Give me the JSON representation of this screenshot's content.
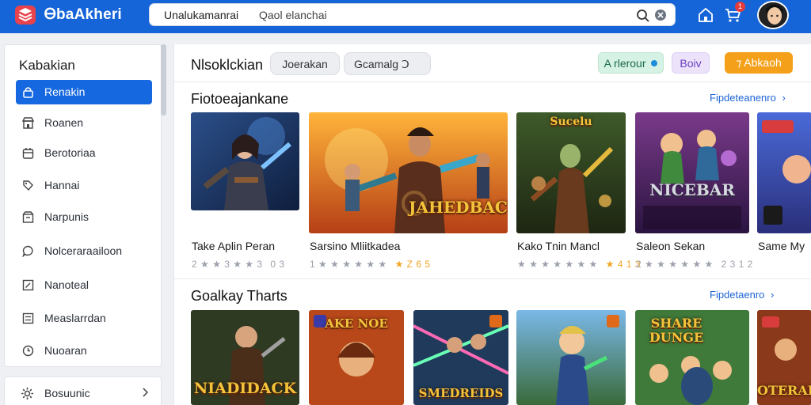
{
  "header": {
    "brand": "ᎾbaAkheri",
    "search_label": "Unalukamanrai",
    "search_placeholder": "Qaol elanchai",
    "notification_count": "1"
  },
  "sidebar": {
    "title": "Kabakian",
    "items": [
      {
        "label": "Renakin",
        "icon": "lock-icon",
        "active": true
      },
      {
        "label": "Roanen",
        "icon": "store-icon"
      },
      {
        "label": "Berotoriaa",
        "icon": "calendar-icon"
      },
      {
        "label": "Hannai",
        "icon": "tag-icon"
      },
      {
        "label": "Narpunis",
        "icon": "box-icon"
      },
      {
        "label": "Nolceraraailoon",
        "icon": "chat-icon"
      },
      {
        "label": "Nanoteal",
        "icon": "edit-icon"
      },
      {
        "label": "Measlarrdan",
        "icon": "list-icon"
      },
      {
        "label": "Nuoaran",
        "icon": "clock-icon"
      }
    ],
    "bottom_item": {
      "label": "Bosuunic",
      "icon": "gear-icon"
    }
  },
  "main": {
    "title": "Nlsoklckian",
    "filters": [
      "Joerakan",
      "Gcamalg Ↄ"
    ],
    "actions": {
      "status": "A rlerour",
      "secondary": "Boiv",
      "primary": "⁊ Abkaoh"
    }
  },
  "sections": [
    {
      "title": "Fiotoeajankane",
      "see_all": "Fipdeteanenro",
      "cards": [
        {
          "title": "Take Aplin Peran",
          "rating": "2 ★ ★ 3 ★ ★ 3",
          "extra": "0 3"
        },
        {
          "title": "Sarsino Mliitkadea",
          "rating": "1 ★ ★ ★ ★ ★ ★",
          "extra": "★ Z 6 5",
          "logo": "JAHEDBACK"
        },
        {
          "title": "Kako Tnin Mancl",
          "rating": "★ ★ ★ ★ ★ ★ ★",
          "extra": "★ 4 1 3",
          "logo": "Sucelu"
        },
        {
          "title": "Saleon Sekan",
          "rating": "2 ★ ★ ★ ★ ★ ★",
          "extra": "2 3 1 2",
          "logo": "NICEBAR"
        },
        {
          "title": "Same My",
          "rating": "",
          "extra": ""
        }
      ]
    },
    {
      "title": "Goalkay Tharts",
      "see_all": "Fipdetaenro",
      "cards": [
        {
          "logo": "NIADIDACK"
        },
        {
          "logo": "AKE NOE"
        },
        {
          "logo": "SMEDREIDS"
        },
        {
          "logo": ""
        },
        {
          "logo": "SHARE DUNGE"
        },
        {
          "logo": "OTERAB"
        }
      ]
    }
  ],
  "colors": {
    "topbar": "#1565d8",
    "active_item": "#1668e0",
    "primary_action": "#f5a01a",
    "status_pill": "#d6f2e4",
    "secondary_pill": "#ece3fb",
    "star": "#f2a623",
    "link": "#1d64d6"
  }
}
